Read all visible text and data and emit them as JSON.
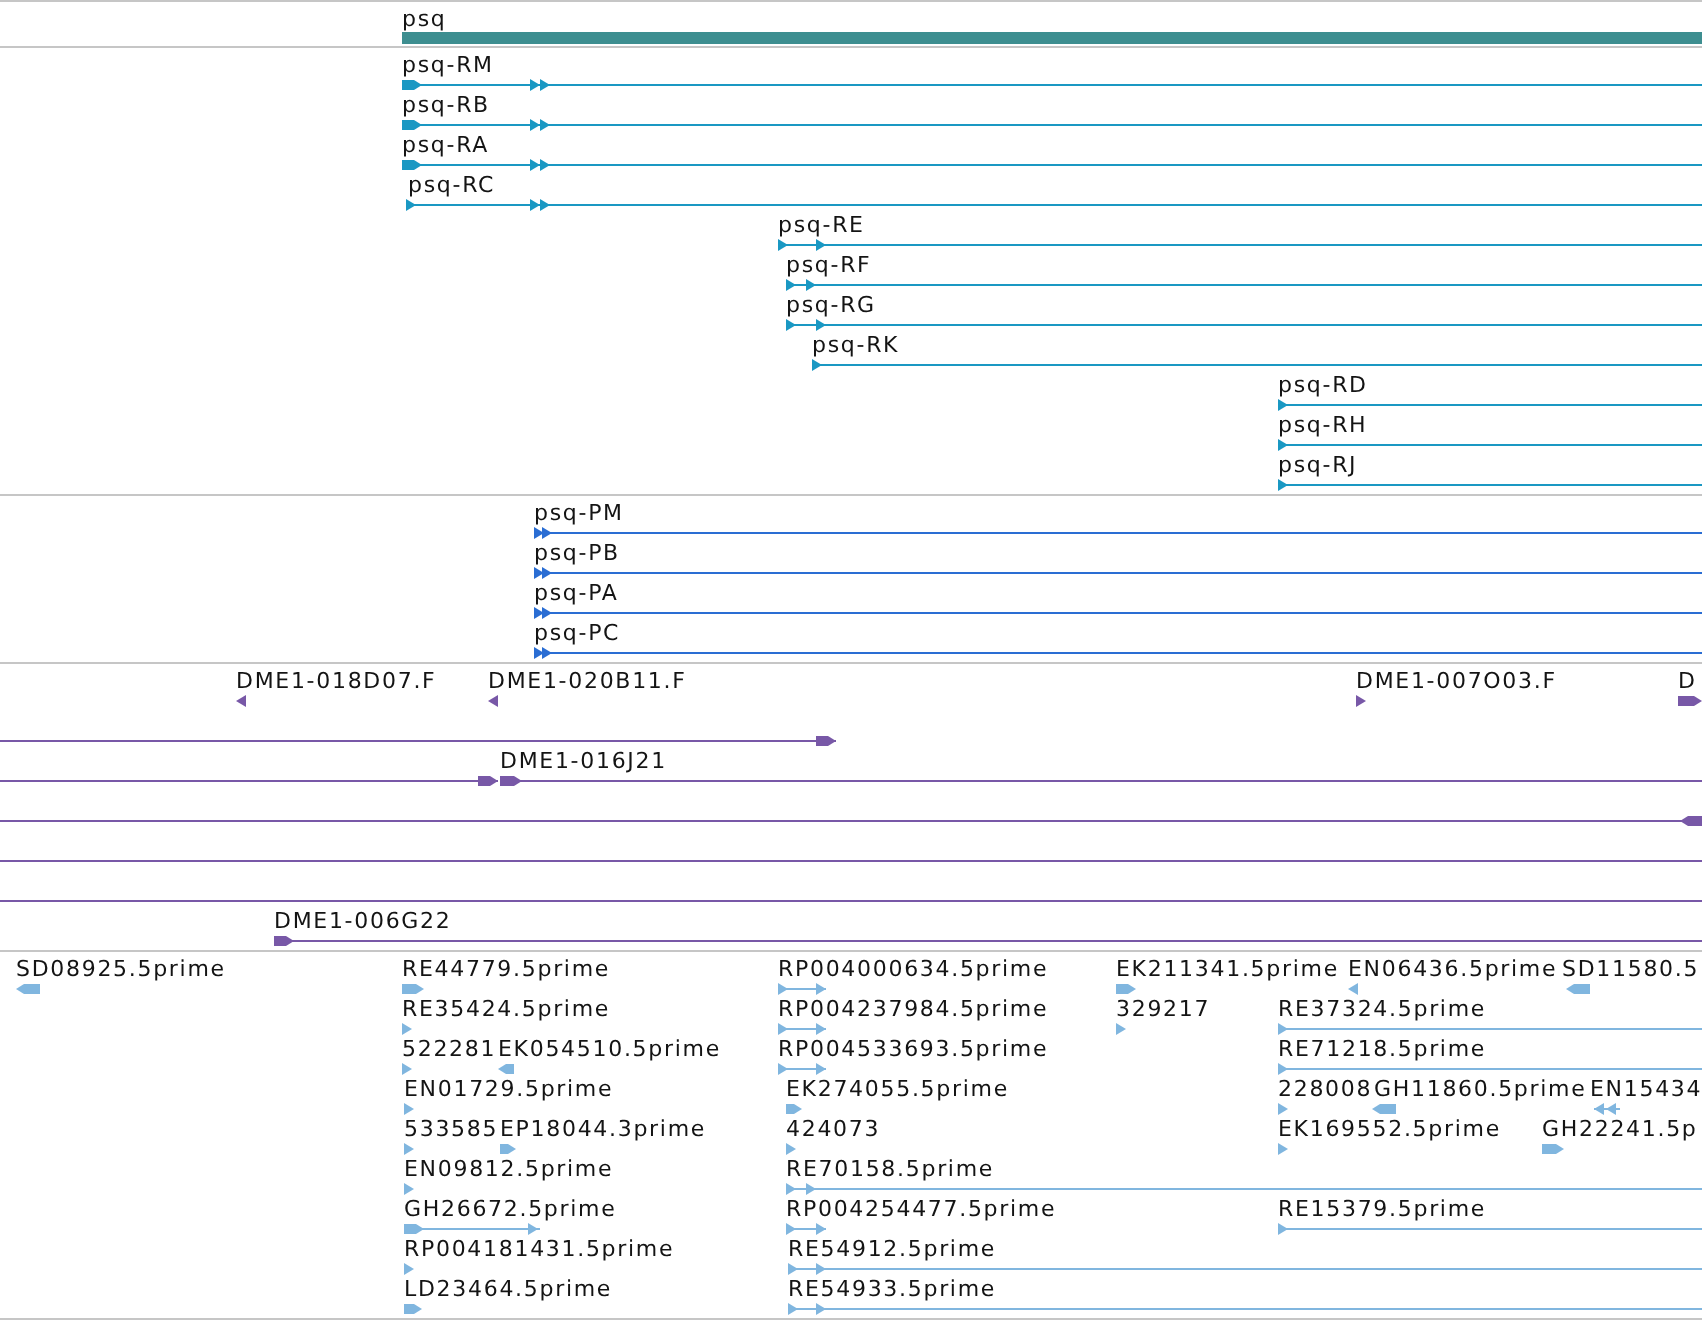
{
  "tracks": [
    {
      "kind": "gene",
      "color": "#3d8e90",
      "features": [
        {
          "label": "psq"
        }
      ]
    },
    {
      "kind": "transcript",
      "color": "#1a98c3",
      "features": [
        {
          "label": "psq-RM",
          "reverse": false
        },
        {
          "label": "psq-RB",
          "reverse": false
        },
        {
          "label": "psq-RA",
          "reverse": false
        },
        {
          "label": "psq-RC",
          "reverse": false
        },
        {
          "label": "psq-RE",
          "reverse": false
        },
        {
          "label": "psq-RF",
          "reverse": false
        },
        {
          "label": "psq-RG",
          "reverse": false
        },
        {
          "label": "psq-RK",
          "reverse": false
        },
        {
          "label": "psq-RD",
          "reverse": false
        },
        {
          "label": "psq-RH",
          "reverse": false
        },
        {
          "label": "psq-RJ",
          "reverse": false
        }
      ]
    },
    {
      "kind": "protein",
      "color": "#2a6dd3",
      "features": [
        {
          "label": "psq-PM",
          "reverse": false
        },
        {
          "label": "psq-PB",
          "reverse": false
        },
        {
          "label": "psq-PA",
          "reverse": false
        },
        {
          "label": "psq-PC",
          "reverse": false
        }
      ]
    },
    {
      "kind": "clone",
      "color": "#7858a7",
      "features": [
        {
          "kind": "arrow",
          "label": "DME1-018D07.F",
          "reverse": true
        },
        {
          "kind": "arrow",
          "label": "DME1-020B11.F",
          "reverse": true
        },
        {
          "kind": "arrow",
          "label": "DME1-007O03.F",
          "reverse": false
        },
        {
          "kind": "arrow",
          "label": "D",
          "reverse": false
        },
        {
          "kind": "arrow",
          "reverse": false
        },
        {
          "kind": "arrow",
          "reverse": false
        },
        {
          "kind": "arrow",
          "label": "DME1-016J21",
          "reverse": false
        },
        {
          "kind": "arrow",
          "reverse": true
        },
        {
          "kind": "line"
        },
        {
          "kind": "line"
        },
        {
          "kind": "arrow",
          "label": "DME1-006G22",
          "reverse": false
        }
      ]
    },
    {
      "kind": "est",
      "color": "#80b6df",
      "features": [
        {
          "label": "SD08925.5prime",
          "reverse": true
        },
        {
          "label": "RE44779.5prime",
          "reverse": false
        },
        {
          "label": "RP004000634.5prime",
          "reverse": false
        },
        {
          "label": "EK211341.5prime",
          "reverse": false
        },
        {
          "label": "EN06436.5prime",
          "reverse": true
        },
        {
          "label": "SD11580.5",
          "reverse": true
        },
        {
          "label": "RE35424.5prime",
          "reverse": false
        },
        {
          "label": "RP004237984.5prime",
          "reverse": false
        },
        {
          "label": "329217",
          "reverse": false
        },
        {
          "label": "RE37324.5prime",
          "reverse": false
        },
        {
          "label": "522281",
          "reverse": false
        },
        {
          "label": "EK054510.5prime",
          "reverse": true
        },
        {
          "label": "RP004533693.5prime",
          "reverse": false
        },
        {
          "label": "RE71218.5prime",
          "reverse": false
        },
        {
          "label": "EN01729.5prime",
          "reverse": false
        },
        {
          "label": "EK274055.5prime",
          "reverse": false
        },
        {
          "label": "228008",
          "reverse": false
        },
        {
          "label": "GH11860.5prime",
          "reverse": true
        },
        {
          "label": "EN15434",
          "reverse": true
        },
        {
          "label": "533585",
          "reverse": false
        },
        {
          "label": "EP18044.3prime",
          "reverse": false
        },
        {
          "label": "424073",
          "reverse": false
        },
        {
          "label": "EK169552.5prime",
          "reverse": false
        },
        {
          "label": "GH22241.5p",
          "reverse": false
        },
        {
          "label": "EN09812.5prime",
          "reverse": false
        },
        {
          "label": "RE70158.5prime",
          "reverse": false
        },
        {
          "label": "GH26672.5prime",
          "reverse": false
        },
        {
          "label": "RP004254477.5prime",
          "reverse": false
        },
        {
          "label": "RE15379.5prime",
          "reverse": false
        },
        {
          "label": "RP004181431.5prime",
          "reverse": false
        },
        {
          "label": "RE54912.5prime",
          "reverse": false
        },
        {
          "label": "LD23464.5prime",
          "reverse": false
        },
        {
          "label": "RE54933.5prime",
          "reverse": false
        }
      ]
    }
  ]
}
